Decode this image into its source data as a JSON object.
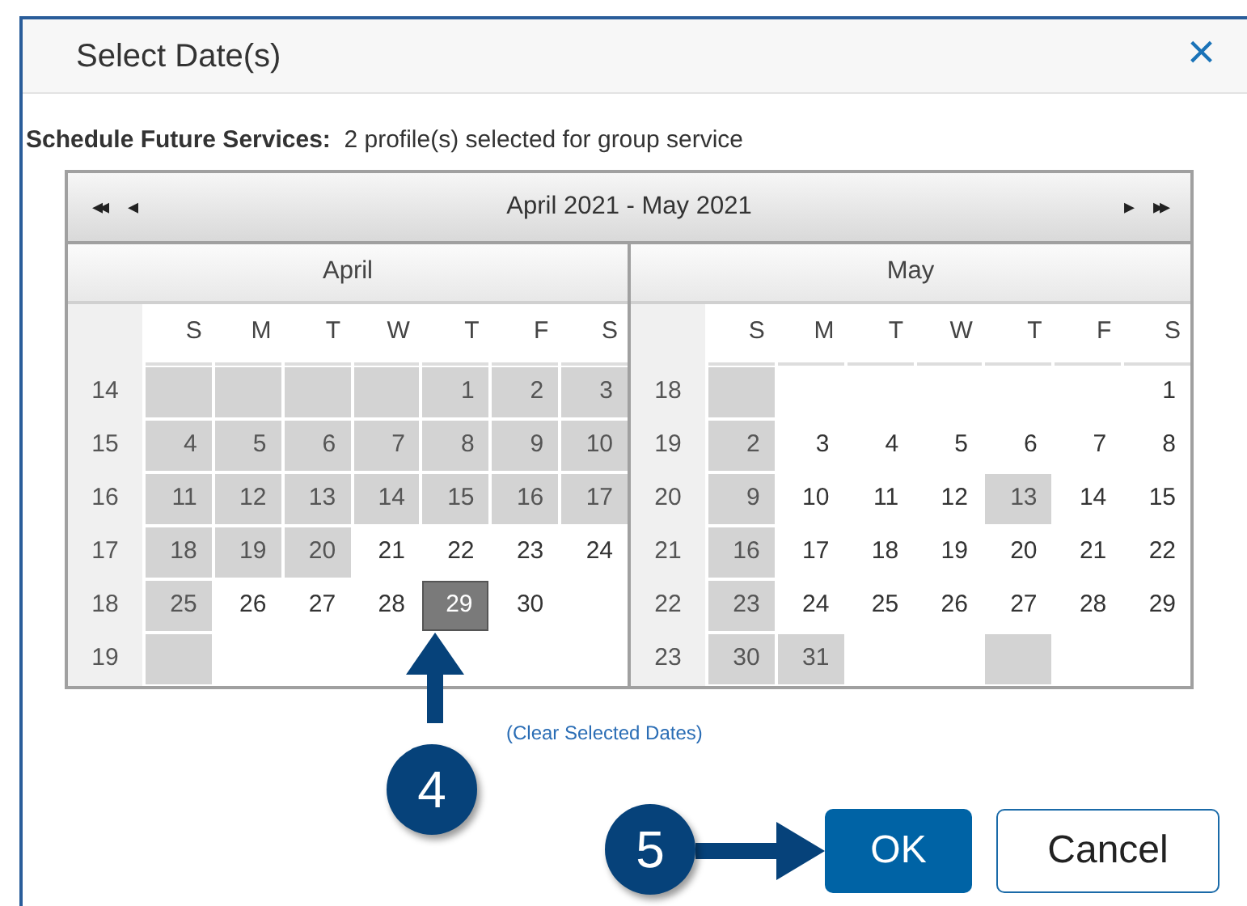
{
  "dialog": {
    "title": "Select Date(s)",
    "close": "×"
  },
  "summary": {
    "label": "Schedule Future Services:",
    "text": "2 profile(s) selected for group service"
  },
  "calendar": {
    "nav": {
      "first": "◂◂",
      "prev": "◂",
      "range": "April 2021 - May 2021",
      "next": "▸",
      "last": "▸▸"
    },
    "months": [
      {
        "name": "April",
        "weekdays": [
          "S",
          "M",
          "T",
          "W",
          "T",
          "F",
          "S"
        ],
        "weeks": [
          {
            "week": "14",
            "days": [
              {
                "kind": "unavailable"
              },
              {
                "kind": "unavailable"
              },
              {
                "kind": "unavailable"
              },
              {
                "kind": "unavailable"
              },
              {
                "text": "1",
                "kind": "unavailable"
              },
              {
                "text": "2",
                "kind": "unavailable"
              },
              {
                "text": "3",
                "kind": "unavailable"
              }
            ]
          },
          {
            "week": "15",
            "days": [
              {
                "text": "4",
                "kind": "unavailable"
              },
              {
                "text": "5",
                "kind": "unavailable"
              },
              {
                "text": "6",
                "kind": "unavailable"
              },
              {
                "text": "7",
                "kind": "unavailable"
              },
              {
                "text": "8",
                "kind": "unavailable"
              },
              {
                "text": "9",
                "kind": "unavailable"
              },
              {
                "text": "10",
                "kind": "unavailable"
              }
            ]
          },
          {
            "week": "16",
            "days": [
              {
                "text": "11",
                "kind": "unavailable"
              },
              {
                "text": "12",
                "kind": "unavailable"
              },
              {
                "text": "13",
                "kind": "unavailable"
              },
              {
                "text": "14",
                "kind": "unavailable"
              },
              {
                "text": "15",
                "kind": "unavailable"
              },
              {
                "text": "16",
                "kind": "unavailable"
              },
              {
                "text": "17",
                "kind": "unavailable"
              }
            ]
          },
          {
            "week": "17",
            "days": [
              {
                "text": "18",
                "kind": "unavailable"
              },
              {
                "text": "19",
                "kind": "unavailable"
              },
              {
                "text": "20",
                "kind": "unavailable"
              },
              {
                "text": "21",
                "kind": "available"
              },
              {
                "text": "22",
                "kind": "available"
              },
              {
                "text": "23",
                "kind": "available"
              },
              {
                "text": "24",
                "kind": "available"
              }
            ]
          },
          {
            "week": "18",
            "days": [
              {
                "text": "25",
                "kind": "unavailable"
              },
              {
                "text": "26",
                "kind": "available"
              },
              {
                "text": "27",
                "kind": "available"
              },
              {
                "text": "28",
                "kind": "available"
              },
              {
                "text": "29",
                "kind": "selected"
              },
              {
                "text": "30",
                "kind": "available"
              },
              {
                "kind": "empty"
              }
            ]
          },
          {
            "week": "19",
            "days": [
              {
                "kind": "unavailable"
              },
              {
                "kind": "empty"
              },
              {
                "kind": "empty"
              },
              {
                "kind": "empty"
              },
              {
                "kind": "empty"
              },
              {
                "kind": "empty"
              },
              {
                "kind": "empty"
              }
            ]
          }
        ]
      },
      {
        "name": "May",
        "weekdays": [
          "S",
          "M",
          "T",
          "W",
          "T",
          "F",
          "S"
        ],
        "weeks": [
          {
            "week": "18",
            "days": [
              {
                "kind": "unavailable"
              },
              {
                "kind": "empty"
              },
              {
                "kind": "empty"
              },
              {
                "kind": "empty"
              },
              {
                "kind": "empty"
              },
              {
                "kind": "empty"
              },
              {
                "text": "1",
                "kind": "available"
              }
            ]
          },
          {
            "week": "19",
            "days": [
              {
                "text": "2",
                "kind": "unavailable"
              },
              {
                "text": "3",
                "kind": "available"
              },
              {
                "text": "4",
                "kind": "available"
              },
              {
                "text": "5",
                "kind": "available"
              },
              {
                "text": "6",
                "kind": "available"
              },
              {
                "text": "7",
                "kind": "available"
              },
              {
                "text": "8",
                "kind": "available"
              }
            ]
          },
          {
            "week": "20",
            "days": [
              {
                "text": "9",
                "kind": "unavailable"
              },
              {
                "text": "10",
                "kind": "available"
              },
              {
                "text": "11",
                "kind": "available"
              },
              {
                "text": "12",
                "kind": "available"
              },
              {
                "text": "13",
                "kind": "unavailable"
              },
              {
                "text": "14",
                "kind": "available"
              },
              {
                "text": "15",
                "kind": "available"
              }
            ]
          },
          {
            "week": "21",
            "days": [
              {
                "text": "16",
                "kind": "unavailable"
              },
              {
                "text": "17",
                "kind": "available"
              },
              {
                "text": "18",
                "kind": "available"
              },
              {
                "text": "19",
                "kind": "available"
              },
              {
                "text": "20",
                "kind": "available"
              },
              {
                "text": "21",
                "kind": "available"
              },
              {
                "text": "22",
                "kind": "available"
              }
            ]
          },
          {
            "week": "22",
            "days": [
              {
                "text": "23",
                "kind": "unavailable"
              },
              {
                "text": "24",
                "kind": "available"
              },
              {
                "text": "25",
                "kind": "available"
              },
              {
                "text": "26",
                "kind": "available"
              },
              {
                "text": "27",
                "kind": "available"
              },
              {
                "text": "28",
                "kind": "available"
              },
              {
                "text": "29",
                "kind": "available"
              }
            ]
          },
          {
            "week": "23",
            "days": [
              {
                "text": "30",
                "kind": "unavailable"
              },
              {
                "text": "31",
                "kind": "unavailable"
              },
              {
                "kind": "empty"
              },
              {
                "kind": "empty"
              },
              {
                "kind": "unavailable"
              },
              {
                "kind": "empty"
              },
              {
                "kind": "empty"
              }
            ]
          }
        ]
      }
    ]
  },
  "clear_link": "(Clear Selected Dates)",
  "buttons": [
    {
      "label": "OK",
      "kind": "primary"
    },
    {
      "label": "Cancel",
      "kind": "secondary"
    }
  ],
  "callouts": [
    {
      "number": "4",
      "kind": "up"
    },
    {
      "number": "5",
      "kind": "right"
    }
  ]
}
